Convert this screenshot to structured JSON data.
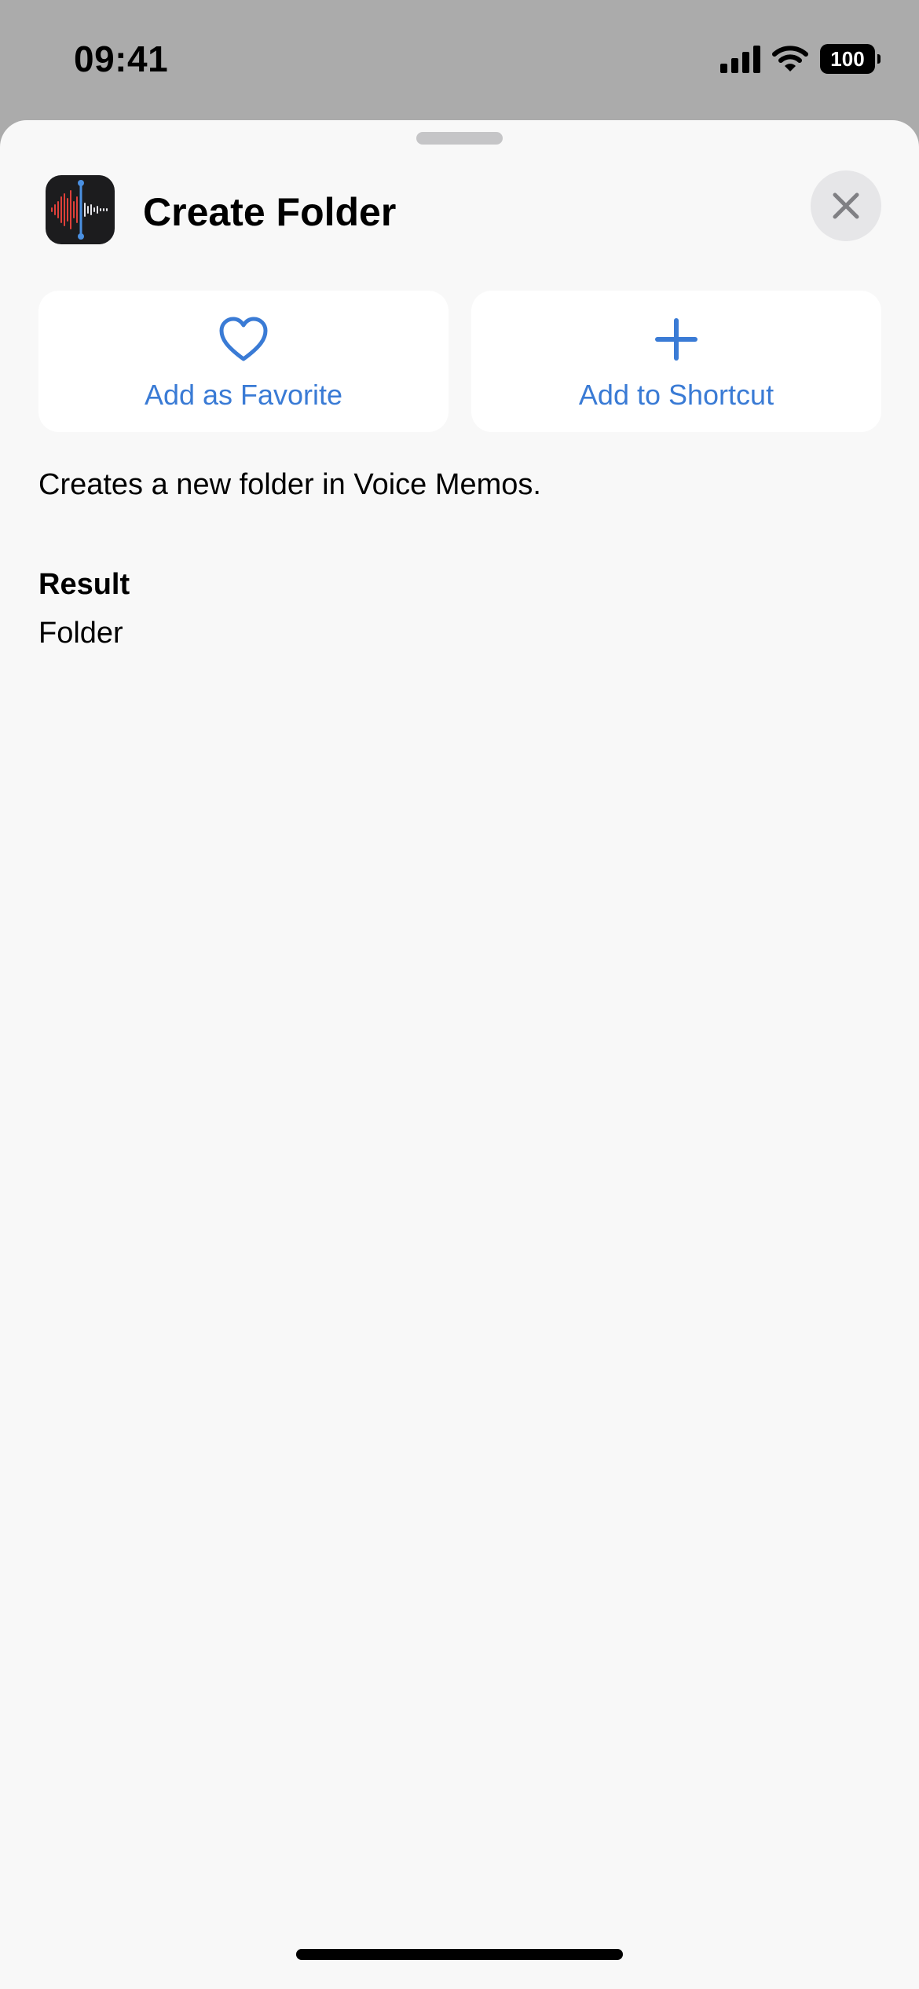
{
  "status_bar": {
    "time": "09:41",
    "battery_level": "100",
    "icons": [
      "cellular-signal-icon",
      "wifi-icon",
      "battery-icon"
    ]
  },
  "sheet": {
    "app_icon": "voice-memos-app-icon",
    "title": "Create Folder",
    "close_icon": "close-icon",
    "actions": [
      {
        "label": "Add as Favorite",
        "icon": "heart-icon"
      },
      {
        "label": "Add to Shortcut",
        "icon": "plus-icon"
      }
    ],
    "description": "Creates a new folder in Voice Memos.",
    "result_heading": "Result",
    "result_value": "Folder"
  },
  "colors": {
    "accent": "#3a7bd5",
    "sheet_background": "#f8f8f8",
    "card_background": "#ffffff",
    "dimmed_background": "#ababab"
  }
}
